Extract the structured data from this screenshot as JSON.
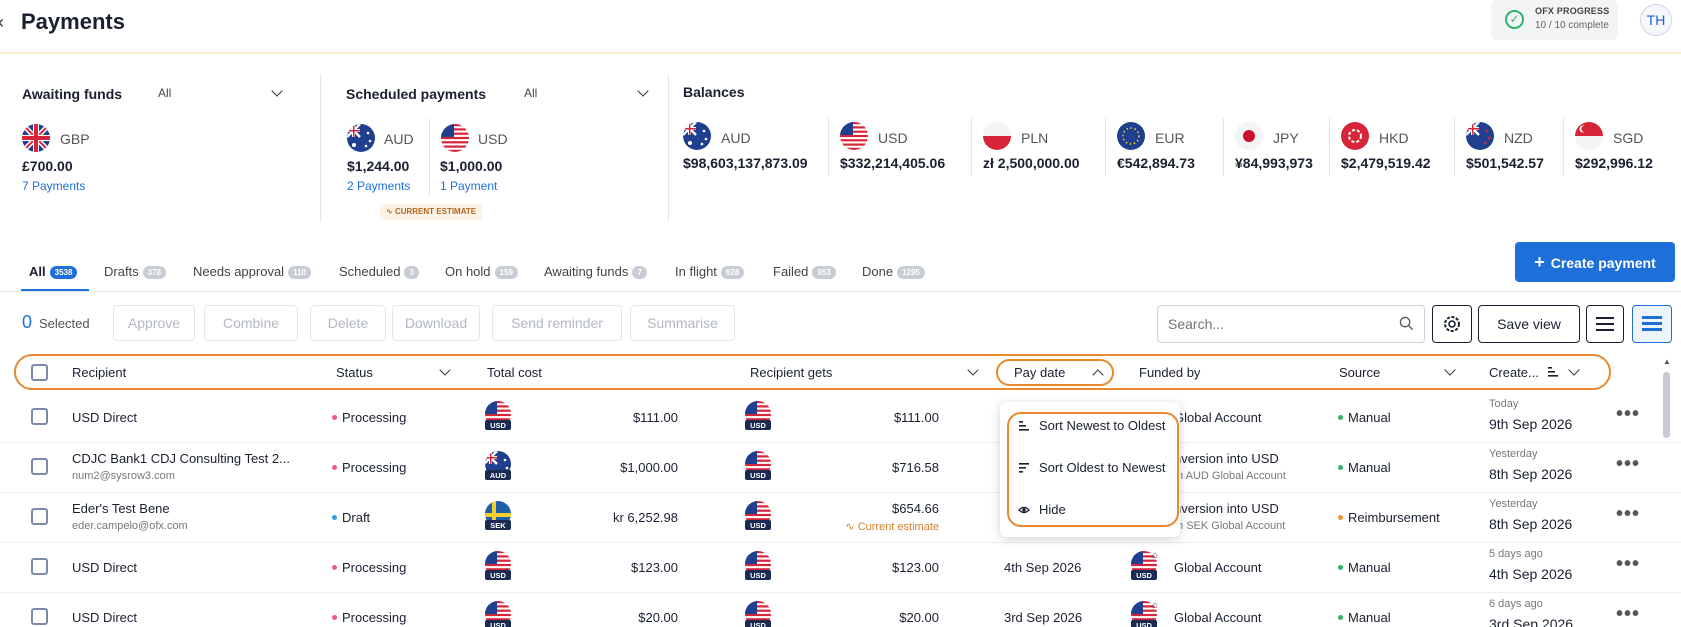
{
  "header": {
    "title": "Payments",
    "ofx_title": "OFX PROGRESS",
    "ofx_sub": "10 / 10 complete",
    "avatar": "TH"
  },
  "awaiting": {
    "title": "Awaiting funds",
    "filter": "All",
    "items": [
      {
        "code": "GBP",
        "amount": "£700.00",
        "link": "7 Payments"
      }
    ]
  },
  "scheduled": {
    "title": "Scheduled payments",
    "filter": "All",
    "items": [
      {
        "code": "AUD",
        "amount": "$1,244.00",
        "link": "2 Payments"
      },
      {
        "code": "USD",
        "amount": "$1,000.00",
        "link": "1 Payment"
      }
    ],
    "estimate": "CURRENT ESTIMATE"
  },
  "balances": {
    "title": "Balances",
    "items": [
      {
        "code": "AUD",
        "amount": "$98,603,137,873.09"
      },
      {
        "code": "USD",
        "amount": "$332,214,405.06"
      },
      {
        "code": "PLN",
        "amount": "zł 2,500,000.00"
      },
      {
        "code": "EUR",
        "amount": "€542,894.73"
      },
      {
        "code": "JPY",
        "amount": "¥84,993,973"
      },
      {
        "code": "HKD",
        "amount": "$2,479,519.42"
      },
      {
        "code": "NZD",
        "amount": "$501,542.57"
      },
      {
        "code": "SGD",
        "amount": "$292,996.12"
      }
    ]
  },
  "tabs": [
    {
      "label": "All",
      "count": "3538"
    },
    {
      "label": "Drafts",
      "count": "378"
    },
    {
      "label": "Needs approval",
      "count": "110"
    },
    {
      "label": "Scheduled",
      "count": "3"
    },
    {
      "label": "On hold",
      "count": "159"
    },
    {
      "label": "Awaiting funds",
      "count": "7"
    },
    {
      "label": "In flight",
      "count": "628"
    },
    {
      "label": "Failed",
      "count": "953"
    },
    {
      "label": "Done",
      "count": "1295"
    }
  ],
  "create_button": "Create payment",
  "actions": {
    "selected_count": "0",
    "selected_label": "Selected",
    "buttons": [
      "Approve",
      "Combine",
      "Delete",
      "Download",
      "Send reminder",
      "Summarise"
    ],
    "search_placeholder": "Search...",
    "save_view": "Save view"
  },
  "columns": {
    "recipient": "Recipient",
    "status": "Status",
    "total_cost": "Total cost",
    "recipient_gets": "Recipient gets",
    "pay_date": "Pay date",
    "funded_by": "Funded by",
    "source": "Source",
    "created": "Create..."
  },
  "rows": [
    {
      "recipient": "USD Direct",
      "email": "",
      "status": "Processing",
      "status_color": "#e85a8a",
      "cost_ccy": "USD",
      "cost": "$111.00",
      "gets_ccy": "USD",
      "gets": "$111.00",
      "gets_note": "",
      "pay_date": "",
      "funded": "Global Account",
      "funded_sub": "",
      "source": "Manual",
      "source_color": "#2fb36e",
      "created_rel": "Today",
      "created": "9th Sep 2026"
    },
    {
      "recipient": "CDJC Bank1 CDJ Consulting Test 2...",
      "email": "num2@sysrow3.com",
      "status": "Processing",
      "status_color": "#e85a8a",
      "cost_ccy": "AUD",
      "cost": "$1,000.00",
      "gets_ccy": "USD",
      "gets": "$716.58",
      "gets_note": "",
      "pay_date": "",
      "funded": "nversion into USD",
      "funded_sub": "m AUD Global Account",
      "source": "Manual",
      "source_color": "#2fb36e",
      "created_rel": "Yesterday",
      "created": "8th Sep 2026"
    },
    {
      "recipient": "Eder's Test Bene",
      "email": "eder.campelo@ofx.com",
      "status": "Draft",
      "status_color": "#2aa7d8",
      "cost_ccy": "SEK",
      "cost": "kr 6,252.98",
      "gets_ccy": "USD",
      "gets": "$654.66",
      "gets_note": "Current estimate",
      "pay_date": "",
      "funded": "nversion into USD",
      "funded_sub": "m SEK Global Account",
      "source": "Reimbursement",
      "source_color": "#f0922e",
      "created_rel": "Yesterday",
      "created": "8th Sep 2026"
    },
    {
      "recipient": "USD Direct",
      "email": "",
      "status": "Processing",
      "status_color": "#e85a8a",
      "cost_ccy": "USD",
      "cost": "$123.00",
      "gets_ccy": "USD",
      "gets": "$123.00",
      "gets_note": "",
      "pay_date": "4th Sep 2026",
      "funded": "Global Account",
      "funded_sub": "",
      "source": "Manual",
      "source_color": "#2fb36e",
      "created_rel": "5 days ago",
      "created": "4th Sep 2026"
    },
    {
      "recipient": "USD Direct",
      "email": "",
      "status": "Processing",
      "status_color": "#e85a8a",
      "cost_ccy": "USD",
      "cost": "$20.00",
      "gets_ccy": "USD",
      "gets": "$20.00",
      "gets_note": "",
      "pay_date": "3rd Sep 2026",
      "funded": "Global Account",
      "funded_sub": "",
      "source": "Manual",
      "source_color": "#2fb36e",
      "created_rel": "6 days ago",
      "created": "3rd Sep 2026"
    }
  ],
  "sort_menu": {
    "items": [
      "Sort Newest to Oldest",
      "Sort Oldest to Newest",
      "Hide"
    ]
  }
}
